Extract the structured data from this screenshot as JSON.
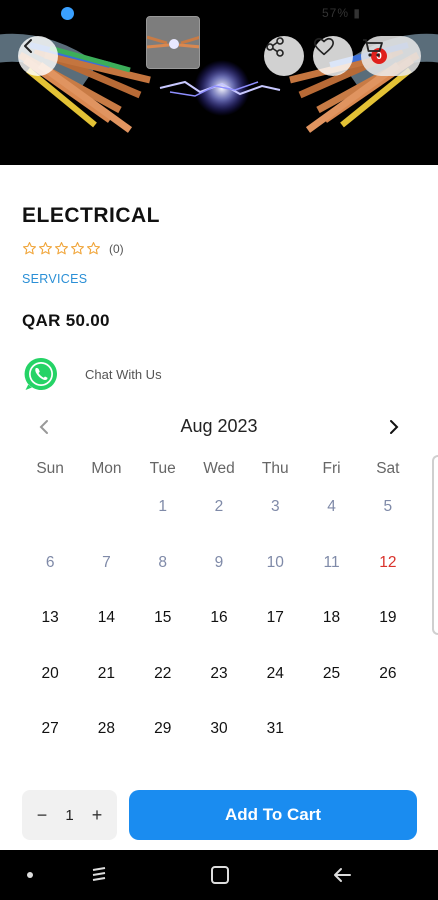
{
  "status_bar": {
    "battery": "57% ▮"
  },
  "header": {
    "back_icon": "arrow-left-icon",
    "share_icon": "share-icon",
    "favorite_icon": "heart-icon",
    "cart_icon": "cart-icon",
    "cart_count": "0"
  },
  "product": {
    "title": "ELECTRICAL",
    "rating_count": "(0)",
    "stars_filled": 0,
    "stars_total": 5,
    "category": "SERVICES",
    "price": "QAR 50.00",
    "chat_label": "Chat With Us"
  },
  "calendar": {
    "month_label": "Aug 2023",
    "weekdays": [
      "Sun",
      "Mon",
      "Tue",
      "Wed",
      "Thu",
      "Fri",
      "Sat"
    ],
    "weeks": [
      [
        "",
        "",
        "1",
        "2",
        "3",
        "4",
        "5"
      ],
      [
        "6",
        "7",
        "8",
        "9",
        "10",
        "11",
        "12"
      ],
      [
        "13",
        "14",
        "15",
        "16",
        "17",
        "18",
        "19"
      ],
      [
        "20",
        "21",
        "22",
        "23",
        "24",
        "25",
        "26"
      ],
      [
        "27",
        "28",
        "29",
        "30",
        "31",
        "",
        ""
      ]
    ],
    "today": "12",
    "first_available": "13"
  },
  "quantity": {
    "minus": "−",
    "value": "1",
    "plus": "+"
  },
  "add_to_cart_label": "Add To Cart",
  "colors": {
    "accent": "#1a8cf0",
    "category_link": "#2a8fd6",
    "today": "#d9322b",
    "past_day": "#7f8aa8",
    "star": "#f0a53a",
    "whatsapp": "#25d366",
    "badge": "#e0201c"
  }
}
